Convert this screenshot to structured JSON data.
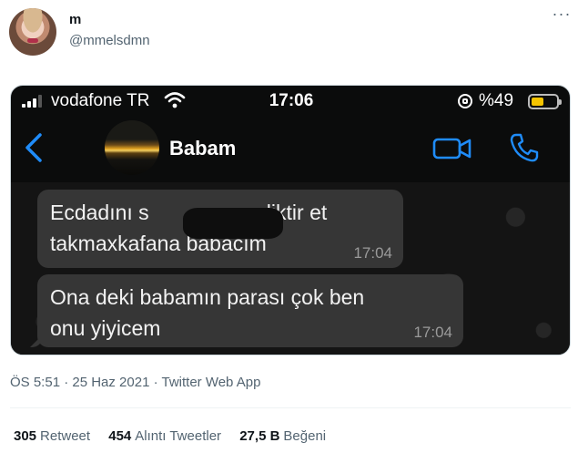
{
  "tweet": {
    "display_name": "m",
    "handle": "@mmelsdmn",
    "more_label": "···",
    "timestamp": "ÖS 5:51 · 25 Haz 2021 · Twitter Web App"
  },
  "stats": [
    {
      "count": "305",
      "label": "Retweet"
    },
    {
      "count": "454",
      "label": "Alıntı Tweetler"
    },
    {
      "count": "27,5 B",
      "label": "Beğeni"
    }
  ],
  "screenshot": {
    "status_bar": {
      "carrier": "vodafone TR",
      "time": "17:06",
      "battery_percent": "%49",
      "battery_level": 0.49,
      "icons": [
        "signal-icon",
        "wifi-icon",
        "orientation-lock-icon",
        "battery-icon"
      ]
    },
    "chat": {
      "contact_name": "Babam",
      "icons": [
        "back-chevron-icon",
        "video-call-icon",
        "phone-icon"
      ],
      "messages": [
        {
          "line1": "Ecdadını s          onun diktir et",
          "line2": "takmaxkafana babacım",
          "time": "17:04"
        },
        {
          "line1": "Ona deki babamın parası çok ben",
          "line2": "onu yiyicem",
          "time": "17:04"
        }
      ]
    },
    "colors": {
      "accent_blue": "#1f8cf9",
      "battery_yellow": "#f5c400",
      "bubble": "#363636"
    }
  }
}
